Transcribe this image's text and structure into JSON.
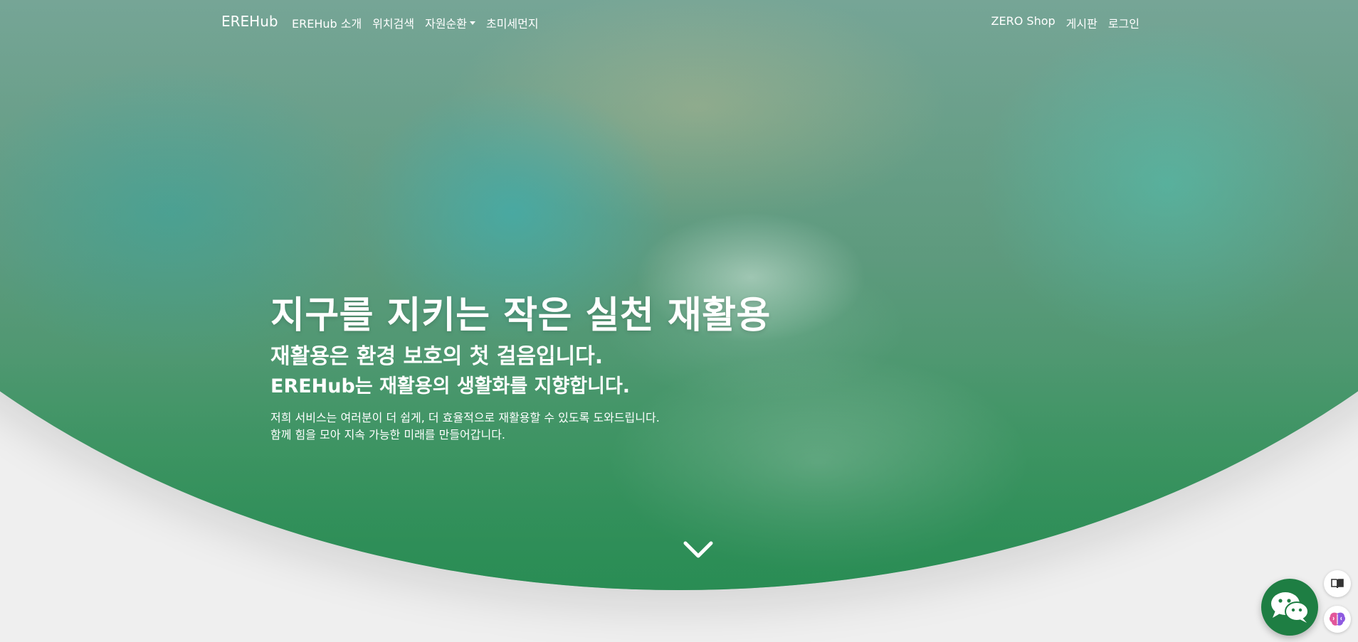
{
  "nav": {
    "brand": "EREHub",
    "left_items": [
      {
        "label": "EREHub 소개"
      },
      {
        "label": "위치검색"
      },
      {
        "label": "자원순환"
      },
      {
        "label": "초미세먼지"
      }
    ],
    "right_items": [
      {
        "label": "ZERO Shop"
      },
      {
        "label": "게시판"
      },
      {
        "label": "로그인"
      }
    ]
  },
  "hero": {
    "title": "지구를 지키는 작은 실천 재활용",
    "subtitle_1": "재활용은 환경 보호의 첫 걸음입니다.",
    "subtitle_2": "EREHub는 재활용의 생활화를 지향합니다.",
    "paragraph_1": "저희 서비스는 여러분이 더 쉽게, 더 효율적으로 재활용할 수 있도록 도와드립니다.",
    "paragraph_2": "함께 힘을 모아 지속 가능한 미래를 만들어갑니다."
  },
  "colors": {
    "accent": "#1e7e43",
    "hero_green": "#2f8a57",
    "page_background": "#efefef",
    "text_on_hero": "#ffffff"
  },
  "icons": {
    "scroll": "chevron-down-icon",
    "chat": "chat-bubbles-icon",
    "reader": "book-icon",
    "assistant": "brain-icon"
  }
}
